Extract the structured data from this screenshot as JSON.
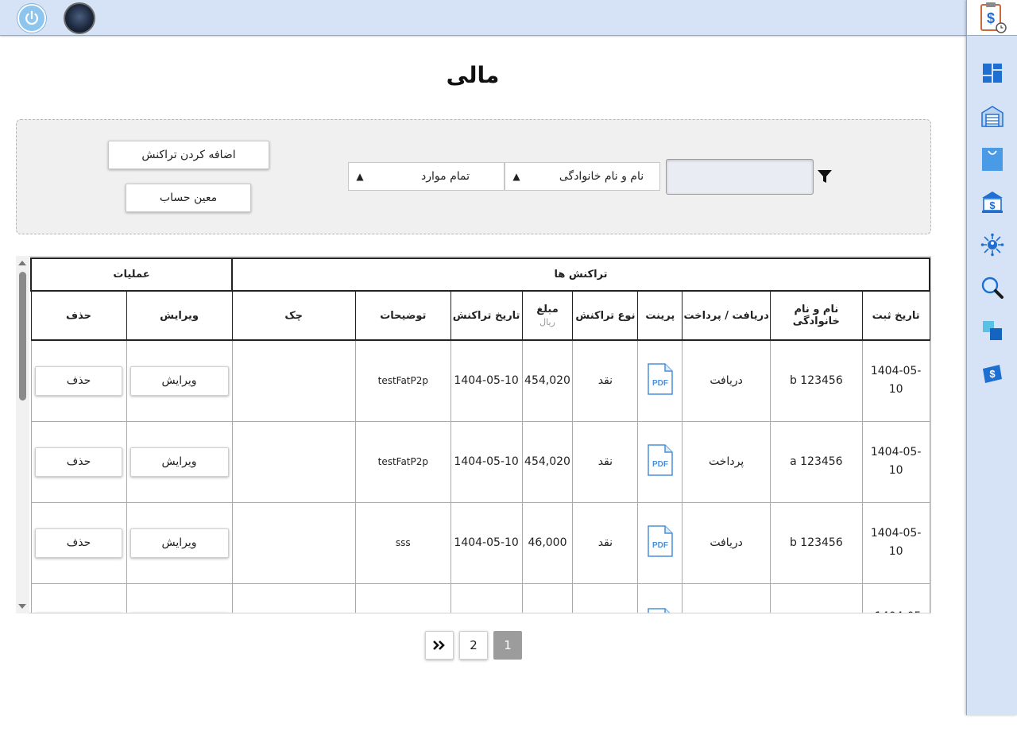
{
  "page": {
    "title": "مالی"
  },
  "toolbar": {
    "add_transaction_label": "اضافه کردن تراکنش",
    "account_label": "معین حساب",
    "filter_name_label": "نام و نام خانوادگی",
    "filter_all_label": "تمام موارد",
    "search_value": ""
  },
  "table": {
    "group_headers": {
      "transactions": "تراکنش ها",
      "operations": "عملیات"
    },
    "headers": {
      "reg_date": "تاریخ ثبت",
      "name": "نام و نام خانوادگی",
      "direction": "دریافت / پرداخت",
      "print": "پرینت",
      "type": "نوع تراکنش",
      "amount": "مبلغ",
      "amount_unit": "ریال",
      "tx_date": "تاریخ تراکنش",
      "description": "توضیحات",
      "check": "چک",
      "edit": "ویرایش",
      "delete": "حذف"
    },
    "rows": [
      {
        "reg_date": "1404-05-10",
        "name": "b 123456",
        "direction": "دریافت",
        "type": "نقد",
        "amount": "454,020",
        "tx_date": "1404-05-10",
        "description": "testFatP2p",
        "check": "",
        "edit": "ویرایش",
        "delete": "حذف"
      },
      {
        "reg_date": "1404-05-10",
        "name": "a 123456",
        "direction": "پرداخت",
        "type": "نقد",
        "amount": "454,020",
        "tx_date": "1404-05-10",
        "description": "testFatP2p",
        "check": "",
        "edit": "ویرایش",
        "delete": "حذف"
      },
      {
        "reg_date": "1404-05-10",
        "name": "b 123456",
        "direction": "دریافت",
        "type": "نقد",
        "amount": "46,000",
        "tx_date": "1404-05-10",
        "description": "sss",
        "check": "",
        "edit": "ویرایش",
        "delete": "حذف"
      },
      {
        "reg_date": "1404-05-",
        "name": "",
        "direction": "",
        "type": "",
        "amount": "",
        "tx_date": "",
        "description": "",
        "check": "",
        "edit": "",
        "delete": ""
      }
    ]
  },
  "pagination": {
    "first_label": "»",
    "pages": [
      "2",
      "1"
    ],
    "current": "1"
  },
  "pdf_label": "PDF",
  "sidebar": {
    "items": [
      "finance-clipboard-icon",
      "dashboard-icon",
      "warehouse-icon",
      "shopping-bag-icon",
      "bank-icon",
      "network-icon",
      "search-icon",
      "layers-icon",
      "ticket-icon"
    ]
  },
  "colors": {
    "accent": "#1e6fd1",
    "bar": "#d6e3f6",
    "panel": "#f0f0f0",
    "active_page": "#9c9c9c"
  }
}
